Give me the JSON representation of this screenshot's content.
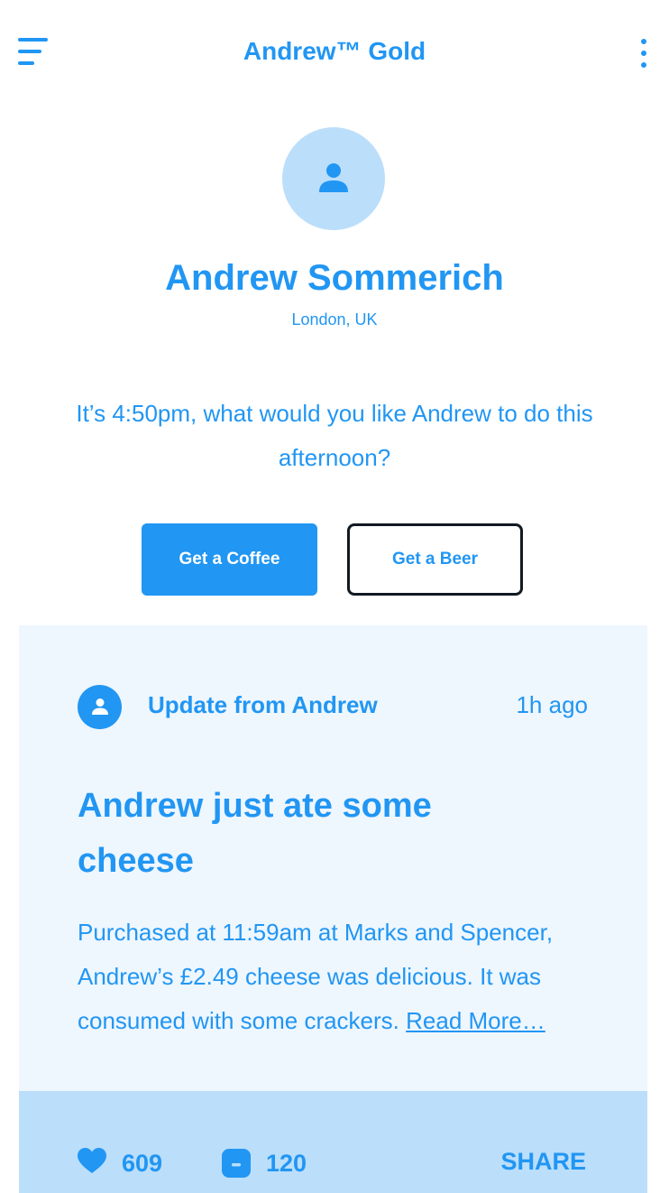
{
  "colors": {
    "primary": "#2196f3",
    "avatar_bg": "#bbdefb",
    "card_bg": "#eef6fe",
    "card_footer_bg": "#bbdefb",
    "beer_border": "#111a22"
  },
  "header": {
    "menu_icon": "hamburger-menu-icon",
    "title": "Andrew™ Gold",
    "more_icon": "more-vertical-icon"
  },
  "profile": {
    "avatar_icon": "user-icon",
    "name": "Andrew Sommerich",
    "location": "London, UK"
  },
  "prompt": {
    "question": "It’s 4:50pm, what would you like Andrew to do this afternoon?"
  },
  "actions": {
    "coffee_label": "Get a Coffee",
    "beer_label": "Get a Beer"
  },
  "card": {
    "avatar_icon": "user-icon",
    "from": "Update from Andrew",
    "time": "1h ago",
    "title": "Andrew just ate some cheese",
    "body": "Purchased at 11:59am at Marks and Spencer, Andrew’s £2.49 cheese was delicious. It was consumed with some crackers. ",
    "read_more": "Read More…",
    "footer": {
      "like_icon": "heart-icon",
      "like_count": "609",
      "comment_icon": "comment-icon",
      "comment_count": "120",
      "share_label": "SHARE"
    }
  }
}
